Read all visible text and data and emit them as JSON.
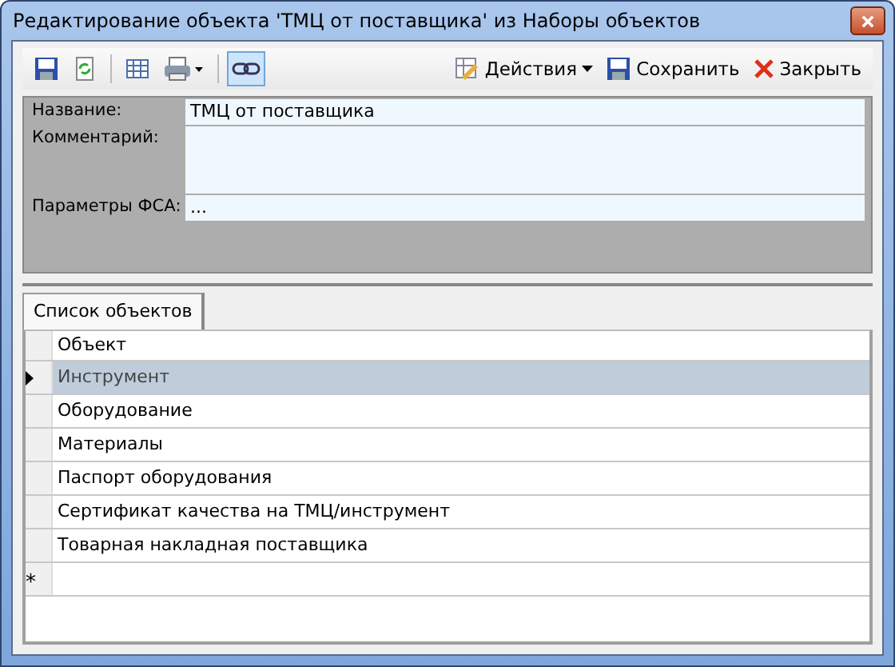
{
  "window": {
    "title": "Редактирование объекта 'ТМЦ от поставщика' из Наборы объектов"
  },
  "toolbar": {
    "link_toggle": {
      "on": true
    },
    "actions": [
      {
        "kind": "menu",
        "label": "Действия"
      },
      {
        "kind": "save",
        "label": "Сохранить"
      },
      {
        "kind": "close",
        "label": "Закрыть"
      }
    ]
  },
  "form": {
    "fields": [
      {
        "kind": "line",
        "label": "Название:",
        "value": "ТМЦ от поставщика"
      },
      {
        "kind": "multiline",
        "label": "Комментарий:"
      },
      {
        "kind": "line",
        "label": "Параметры ФСА:",
        "value": "..."
      }
    ]
  },
  "tabs": [
    {
      "label": "Список объектов",
      "selected": true
    }
  ],
  "table": {
    "columns": [
      "Объект"
    ],
    "rows": [
      {
        "cells": [
          "Инструмент"
        ],
        "selected": true
      },
      {
        "cells": [
          "Оборудование"
        ],
        "selected": false
      },
      {
        "cells": [
          "Материалы"
        ],
        "selected": false
      },
      {
        "cells": [
          "Паспорт оборудования"
        ],
        "selected": false
      },
      {
        "cells": [
          "Сертификат качества на ТМЦ/инструмент"
        ],
        "selected": false
      },
      {
        "cells": [
          "Товарная накладная поставщика"
        ],
        "selected": false
      }
    ],
    "new_row_marker": "*"
  }
}
